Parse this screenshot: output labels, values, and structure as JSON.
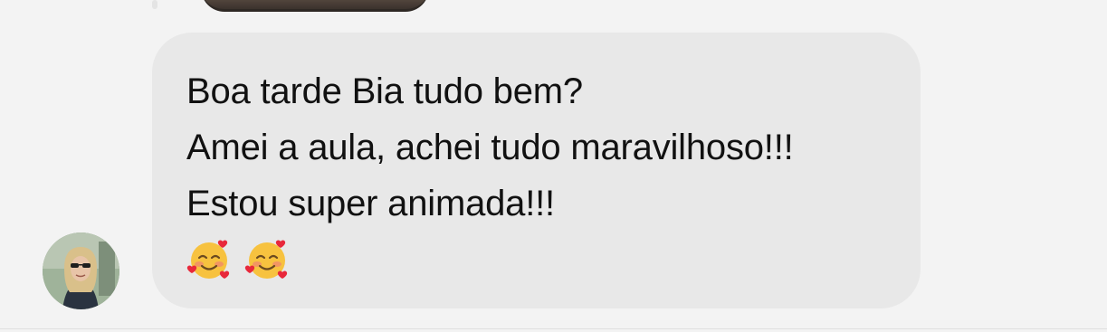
{
  "conversation": {
    "message": {
      "lines": [
        "Boa tarde Bia tudo bem?",
        "Amei a aula, achei tudo maravilhoso!!!",
        "Estou super animada!!!"
      ],
      "emojis": [
        "smiling-face-with-hearts",
        "smiling-face-with-hearts"
      ]
    },
    "colors": {
      "background": "#f3f3f3",
      "bubble": "#e8e8e8",
      "text": "#111111"
    }
  }
}
